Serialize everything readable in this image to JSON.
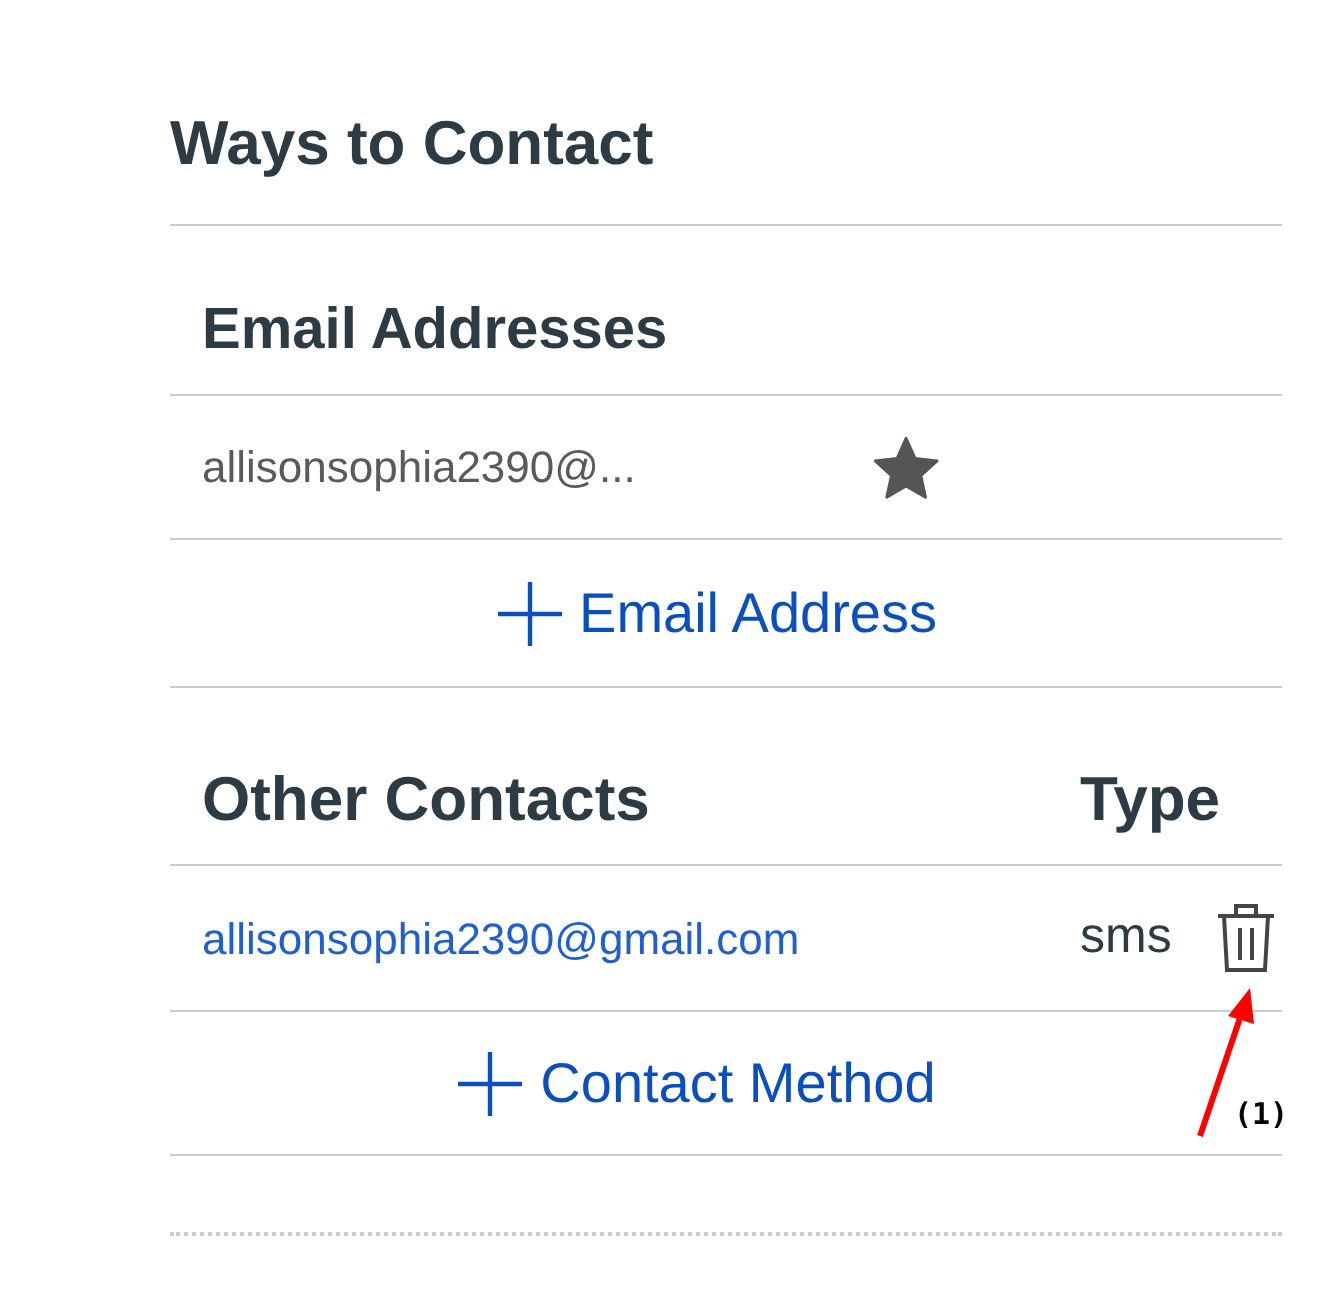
{
  "section_title": "Ways to Contact",
  "email_addresses": {
    "heading": "Email Addresses",
    "items": [
      {
        "address": "allisonsophia2390@...",
        "default": true
      }
    ],
    "add_link": "Email Address"
  },
  "other_contacts": {
    "heading": "Other Contacts",
    "type_heading": "Type",
    "items": [
      {
        "address": "allisonsophia2390@gmail.com",
        "type": "sms"
      }
    ],
    "add_link": "Contact Method"
  },
  "annotation": {
    "label": "(1)"
  }
}
